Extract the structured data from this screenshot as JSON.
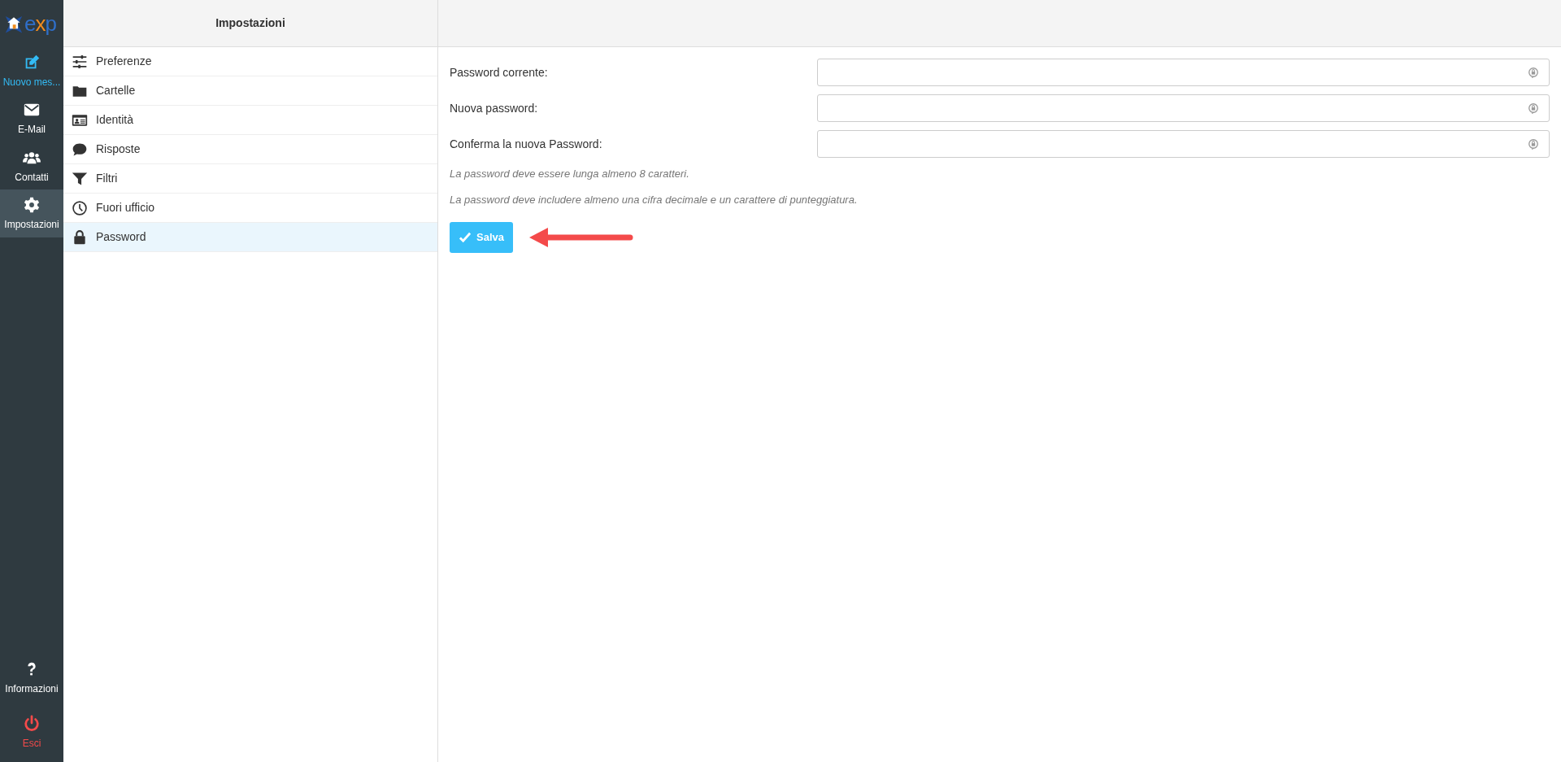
{
  "logo": {
    "text": "exp"
  },
  "nav": {
    "items": [
      {
        "label": "Nuovo mes...",
        "kind": "compose",
        "color": "#33bbf5",
        "selected": false
      },
      {
        "label": "E-Mail",
        "kind": "mail",
        "color": "#ffffff",
        "selected": false
      },
      {
        "label": "Contatti",
        "kind": "contacts",
        "color": "#ffffff",
        "selected": false
      },
      {
        "label": "Impostazioni",
        "kind": "settings",
        "color": "#ffffff",
        "selected": true
      }
    ],
    "bottom_items": [
      {
        "label": "Informazioni",
        "kind": "help",
        "color": "#ffffff",
        "selected": false
      },
      {
        "label": "Esci",
        "kind": "logout",
        "color": "#f44a4a",
        "selected": false
      }
    ]
  },
  "settings": {
    "title": "Impostazioni",
    "items": [
      {
        "label": "Preferenze",
        "kind": "sliders",
        "selected": false
      },
      {
        "label": "Cartelle",
        "kind": "folder",
        "selected": false
      },
      {
        "label": "Identità",
        "kind": "idcard",
        "selected": false
      },
      {
        "label": "Risposte",
        "kind": "comment",
        "selected": false
      },
      {
        "label": "Filtri",
        "kind": "filter",
        "selected": false
      },
      {
        "label": "Fuori ufficio",
        "kind": "clock",
        "selected": false
      },
      {
        "label": "Password",
        "kind": "lock",
        "selected": true
      }
    ]
  },
  "form": {
    "fields": [
      {
        "label": "Password corrente:"
      },
      {
        "label": "Nuova password:"
      },
      {
        "label": "Conferma la nuova Password:"
      }
    ],
    "hints": [
      "La password deve essere lunga almeno 8 caratteri.",
      "La password deve includere almeno una cifra decimale e un carattere di punteggiatura."
    ],
    "save_button": "Salva"
  }
}
